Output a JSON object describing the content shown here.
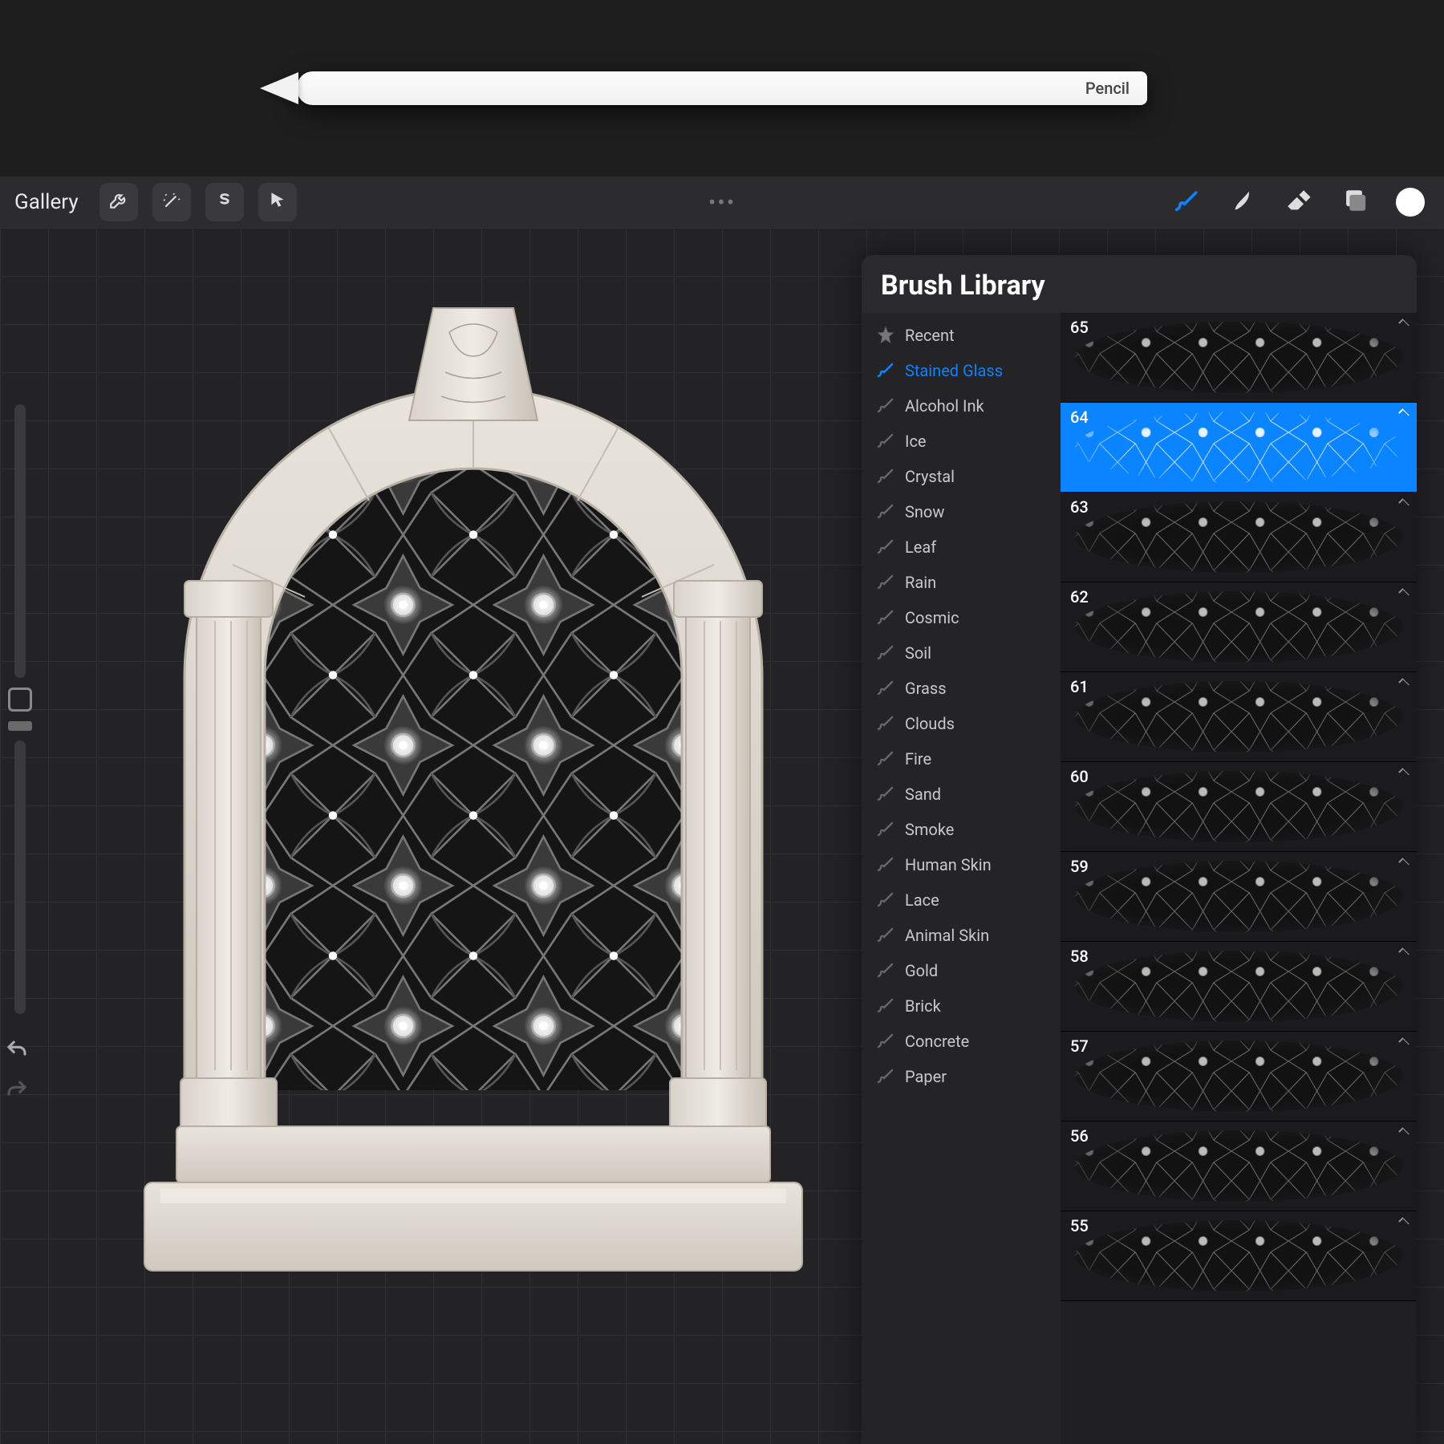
{
  "pencil_label": "Pencil",
  "toolbar": {
    "gallery_label": "Gallery",
    "more_glyph": "•••"
  },
  "panel": {
    "title": "Brush Library"
  },
  "categories": [
    {
      "label": "Recent",
      "type": "star"
    },
    {
      "label": "Stained Glass",
      "type": "brush",
      "active": true
    },
    {
      "label": "Alcohol Ink",
      "type": "brush"
    },
    {
      "label": "Ice",
      "type": "brush"
    },
    {
      "label": "Crystal",
      "type": "brush"
    },
    {
      "label": "Snow",
      "type": "brush"
    },
    {
      "label": "Leaf",
      "type": "brush"
    },
    {
      "label": "Rain",
      "type": "brush"
    },
    {
      "label": "Cosmic",
      "type": "brush"
    },
    {
      "label": "Soil",
      "type": "brush"
    },
    {
      "label": "Grass",
      "type": "brush"
    },
    {
      "label": "Clouds",
      "type": "brush"
    },
    {
      "label": "Fire",
      "type": "brush"
    },
    {
      "label": "Sand",
      "type": "brush"
    },
    {
      "label": "Smoke",
      "type": "brush"
    },
    {
      "label": "Human Skin",
      "type": "brush"
    },
    {
      "label": "Lace",
      "type": "brush"
    },
    {
      "label": "Animal Skin",
      "type": "brush"
    },
    {
      "label": "Gold",
      "type": "brush"
    },
    {
      "label": "Brick",
      "type": "brush"
    },
    {
      "label": "Concrete",
      "type": "brush"
    },
    {
      "label": "Paper",
      "type": "brush"
    }
  ],
  "brushes": [
    {
      "num": "65",
      "selected": false
    },
    {
      "num": "64",
      "selected": true
    },
    {
      "num": "63",
      "selected": false
    },
    {
      "num": "62",
      "selected": false
    },
    {
      "num": "61",
      "selected": false
    },
    {
      "num": "60",
      "selected": false
    },
    {
      "num": "59",
      "selected": false
    },
    {
      "num": "58",
      "selected": false
    },
    {
      "num": "57",
      "selected": false
    },
    {
      "num": "56",
      "selected": false
    },
    {
      "num": "55",
      "selected": false
    }
  ],
  "colors": {
    "accent": "#0a84ff"
  }
}
